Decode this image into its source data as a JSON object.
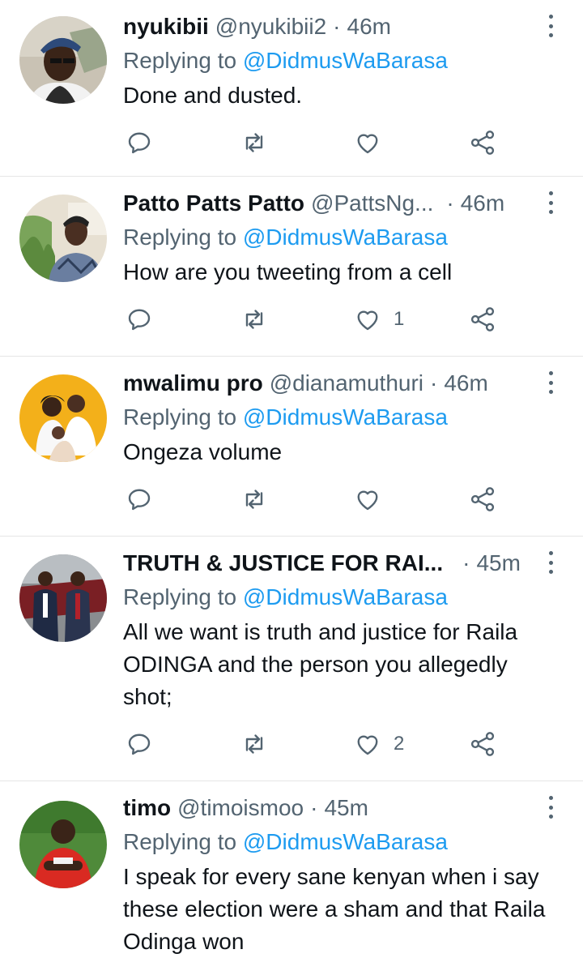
{
  "reply_prefix": "Replying to",
  "colors": {
    "mention": "#1d9bf0",
    "muted": "#536471",
    "divider": "#e6e6e6"
  },
  "icons": {
    "reply": "reply-icon",
    "retweet": "retweet-icon",
    "like": "like-icon",
    "share": "share-icon",
    "more": "more-icon"
  },
  "tweets": [
    {
      "name": "nyukibii",
      "handle": "@nyukibii2",
      "time": "46m",
      "mention": "@DidmusWaBarasa",
      "text": "Done and dusted.",
      "likes": ""
    },
    {
      "name": "Patto Patts Patto",
      "handle": "@PattsNg...",
      "time": "46m",
      "mention": "@DidmusWaBarasa",
      "text": "How are you tweeting from a cell",
      "likes": "1"
    },
    {
      "name": "mwalimu pro",
      "handle": "@dianamuthuri",
      "time": "46m",
      "mention": "@DidmusWaBarasa",
      "text": "Ongeza volume",
      "likes": ""
    },
    {
      "name": "TRUTH & JUSTICE FOR RAI...",
      "handle": "",
      "time": "45m",
      "mention": "@DidmusWaBarasa",
      "text": "All we want is truth and justice for Raila ODINGA and the person you allegedly shot;",
      "likes": "2"
    },
    {
      "name": "timo",
      "handle": "@timoismoo",
      "time": "45m",
      "mention": "@DidmusWaBarasa",
      "text": "I speak for every sane kenyan when i say these election were a sham and that Raila Odinga won",
      "likes": ""
    }
  ]
}
